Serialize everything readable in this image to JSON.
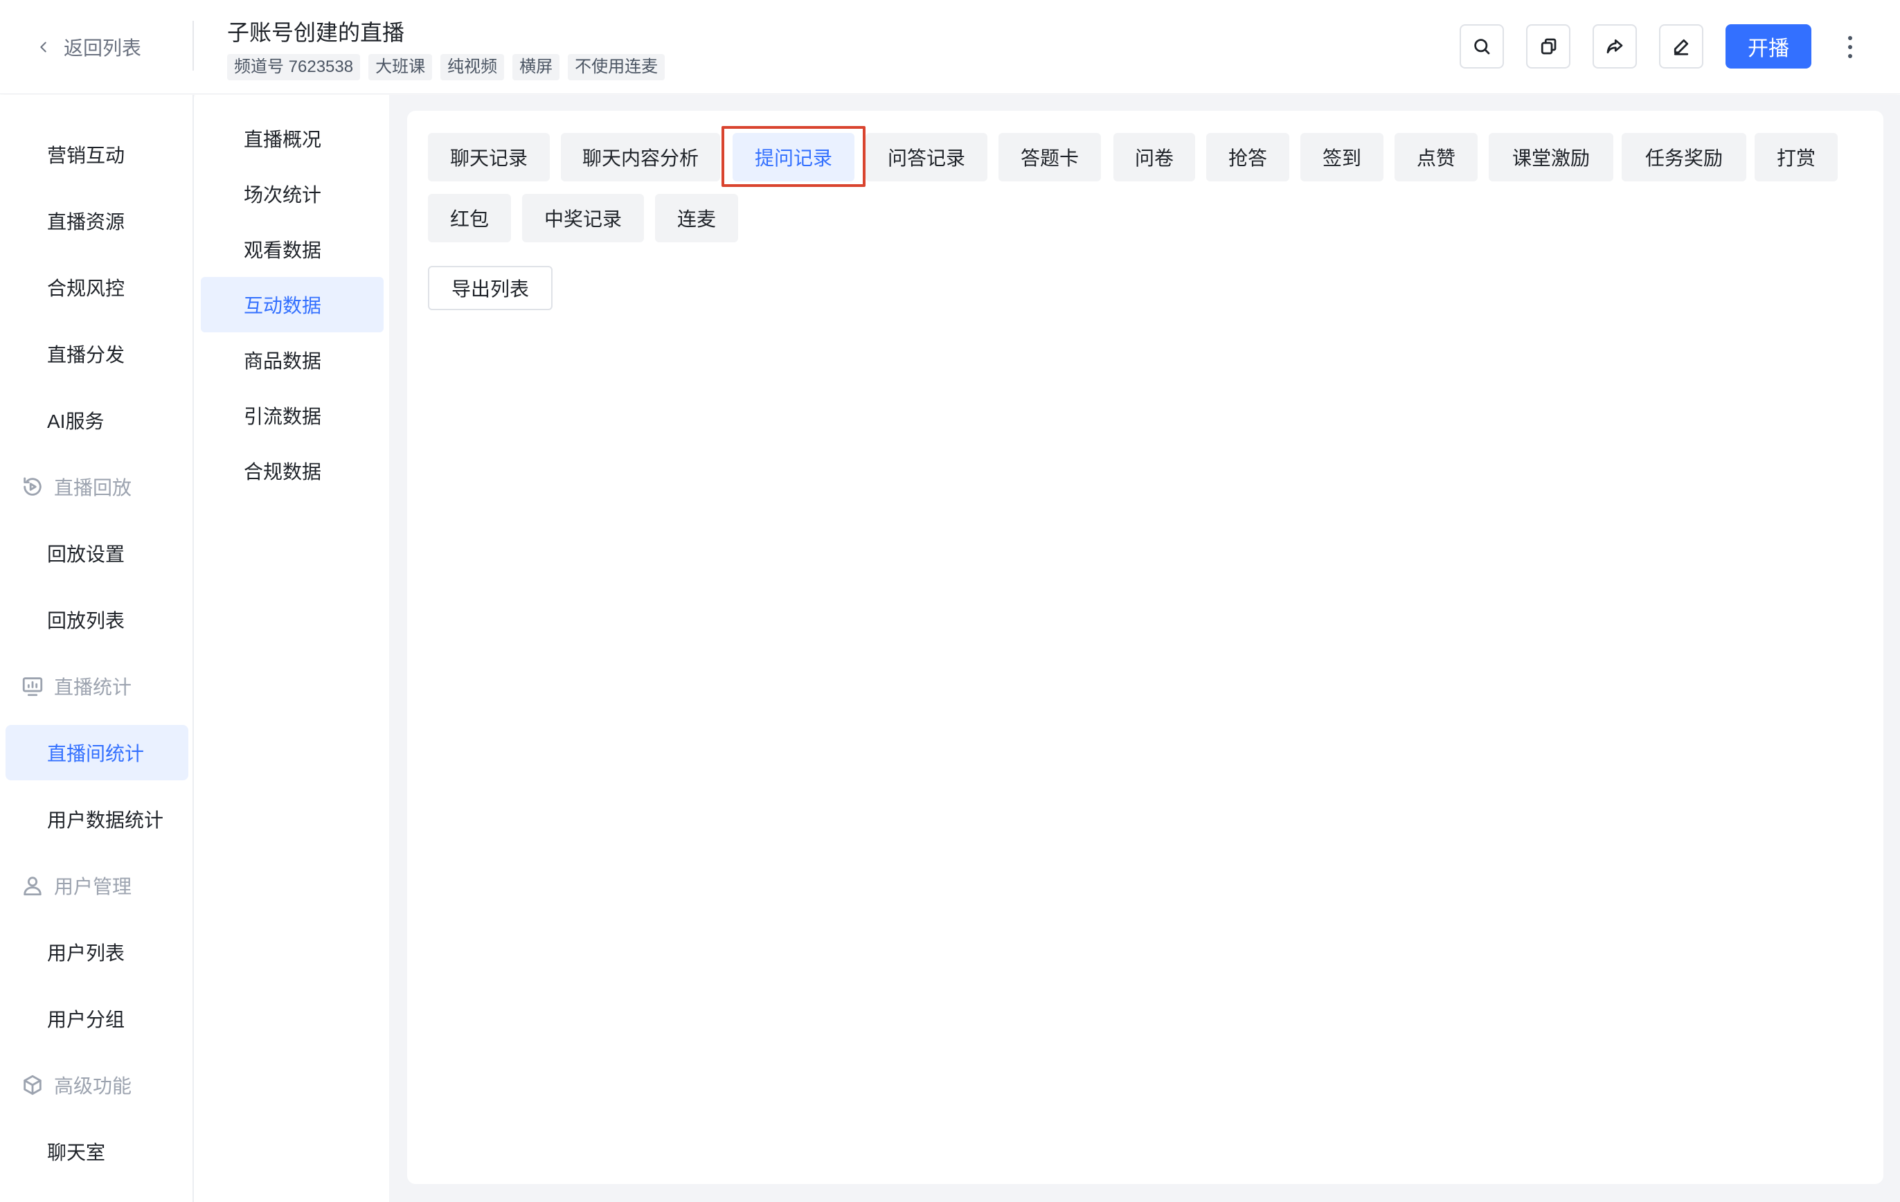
{
  "header": {
    "back_label": "返回列表",
    "title": "子账号创建的直播",
    "tags": [
      "频道号 7623538",
      "大班课",
      "纯视频",
      "横屏",
      "不使用连麦"
    ],
    "start_label": "开播"
  },
  "sidebar": {
    "items": [
      {
        "label": "营销互动",
        "type": "item"
      },
      {
        "label": "直播资源",
        "type": "item"
      },
      {
        "label": "合规风控",
        "type": "item"
      },
      {
        "label": "直播分发",
        "type": "item"
      },
      {
        "label": "AI服务",
        "type": "item"
      },
      {
        "label": "直播回放",
        "type": "group",
        "icon": "replay-icon"
      },
      {
        "label": "回放设置",
        "type": "item"
      },
      {
        "label": "回放列表",
        "type": "item"
      },
      {
        "label": "直播统计",
        "type": "group",
        "icon": "stats-monitor-icon"
      },
      {
        "label": "直播间统计",
        "type": "item",
        "active": true
      },
      {
        "label": "用户数据统计",
        "type": "item"
      },
      {
        "label": "用户管理",
        "type": "group",
        "icon": "user-icon"
      },
      {
        "label": "用户列表",
        "type": "item"
      },
      {
        "label": "用户分组",
        "type": "item"
      },
      {
        "label": "高级功能",
        "type": "group",
        "icon": "cube-icon"
      },
      {
        "label": "聊天室",
        "type": "item"
      }
    ]
  },
  "subnav": {
    "items": [
      "直播概况",
      "场次统计",
      "观看数据",
      "互动数据",
      "商品数据",
      "引流数据",
      "合规数据"
    ],
    "active_index": 3
  },
  "tabs": {
    "items": [
      "聊天记录",
      "聊天内容分析",
      "提问记录",
      "问答记录",
      "答题卡",
      "问卷",
      "抢答",
      "签到",
      "点赞",
      "课堂激励",
      "任务奖励",
      "打赏",
      "红包",
      "中奖记录",
      "连麦"
    ],
    "active_index": 2
  },
  "actions": {
    "export_label": "导出列表"
  },
  "colors": {
    "accent": "#3370ff",
    "active_bg": "#eaf1ff",
    "highlight_border": "#d9442f"
  }
}
